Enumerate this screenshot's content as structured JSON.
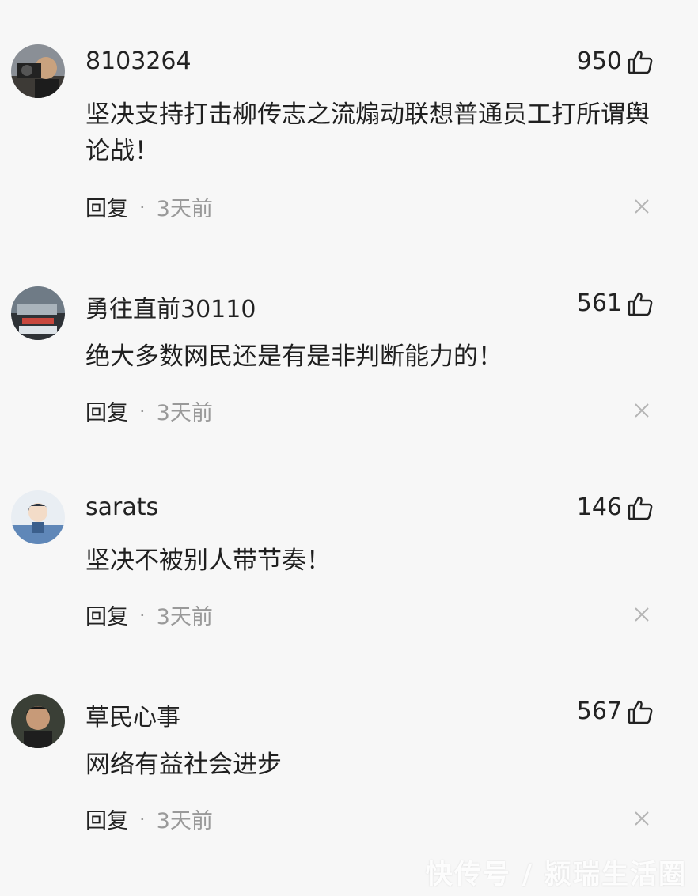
{
  "comments": [
    {
      "username": "8103264",
      "likes": "950",
      "text": "坚决支持打击柳传志之流煽动联想普通员工打所谓舆论战！",
      "reply_label": "回复",
      "separator": "·",
      "time": "3天前"
    },
    {
      "username": "勇往直前30110",
      "likes": "561",
      "text": "绝大多数网民还是有是非判断能力的！",
      "reply_label": "回复",
      "separator": "·",
      "time": "3天前"
    },
    {
      "username": "sarats",
      "likes": "146",
      "text": "坚决不被别人带节奏！",
      "reply_label": "回复",
      "separator": "·",
      "time": "3天前"
    },
    {
      "username": "草民心事",
      "likes": "567",
      "text": "网络有益社会进步",
      "reply_label": "回复",
      "separator": "·",
      "time": "3天前"
    }
  ],
  "watermark": "快传号 / 颍瑞生活圈",
  "icons": {
    "like": "thumbs-up-icon",
    "close": "close-icon"
  }
}
